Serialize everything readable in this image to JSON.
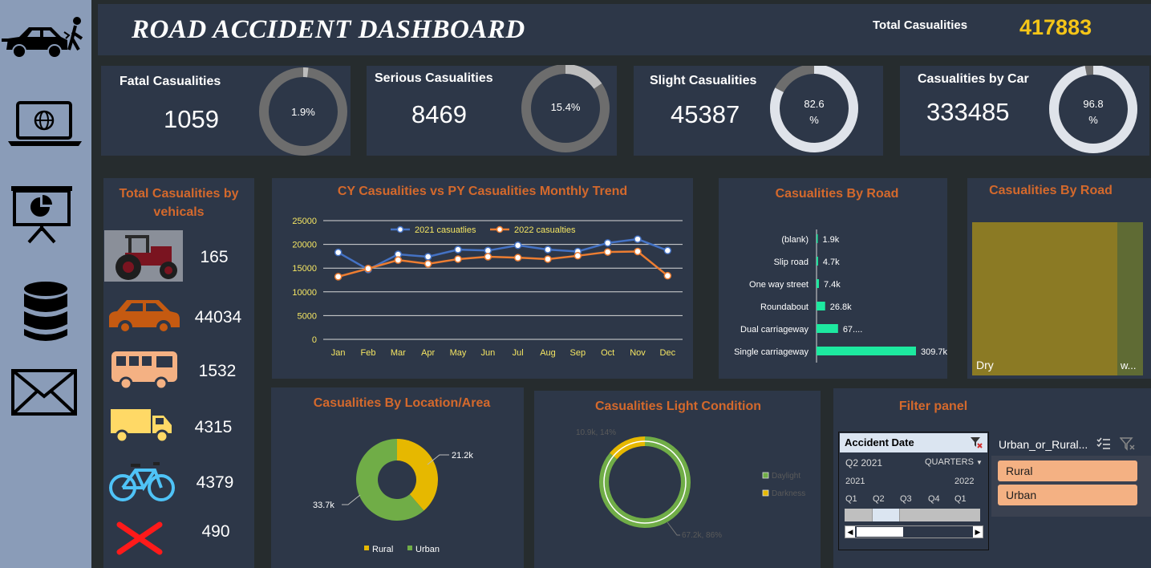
{
  "header": {
    "title": "ROAD ACCIDENT DASHBOARD",
    "total_label": "Total Casualities",
    "total_value": "417883"
  },
  "sidebar": {
    "icons": [
      "car-crash-icon",
      "laptop-globe-icon",
      "presentation-chart-icon",
      "database-icon",
      "mail-icon"
    ]
  },
  "kpis": [
    {
      "label": "Fatal Casualities",
      "value": "1059",
      "pct_text": "1.9%",
      "pct": 1.9
    },
    {
      "label": "Serious Casualities",
      "value": "8469",
      "pct_text": "15.4%",
      "pct": 15.4
    },
    {
      "label": "Slight Casualities",
      "value": "45387",
      "pct_text_line1": "82.6",
      "pct_text_line2": "%",
      "pct": 82.6
    },
    {
      "label": "Casualities by Car",
      "value": "333485",
      "pct_text_line1": "96.8",
      "pct_text_line2": "%",
      "pct": 96.8
    }
  ],
  "vehicles": {
    "title_line1": "Total Casualities by",
    "title_line2": "vehicals",
    "items": [
      {
        "icon": "tractor-icon",
        "value": "165"
      },
      {
        "icon": "car-icon",
        "value": "44034"
      },
      {
        "icon": "bus-icon",
        "value": "1532"
      },
      {
        "icon": "truck-icon",
        "value": "4315"
      },
      {
        "icon": "bicycle-icon",
        "value": "4379"
      },
      {
        "icon": "cross-icon",
        "value": "490"
      }
    ]
  },
  "trend": {
    "title": "CY Casualities vs PY Casualities Monthly Trend",
    "chart_data": {
      "type": "line",
      "categories": [
        "Jan",
        "Feb",
        "Mar",
        "Apr",
        "May",
        "Jun",
        "Jul",
        "Aug",
        "Sep",
        "Oct",
        "Nov",
        "Dec"
      ],
      "series": [
        {
          "name": "2021 casuatlies",
          "color": "#4472c4",
          "values": [
            18300,
            14700,
            17900,
            17400,
            18900,
            18700,
            19800,
            18900,
            18500,
            20300,
            21100,
            18700
          ]
        },
        {
          "name": "2022 casualties",
          "color": "#ed7d31",
          "values": [
            13200,
            14900,
            16700,
            15900,
            16900,
            17400,
            17200,
            16900,
            17600,
            18400,
            18500,
            13400
          ]
        }
      ],
      "yticks": [
        "0",
        "5000",
        "10000",
        "15000",
        "20000",
        "25000"
      ],
      "ylim": [
        0,
        25000
      ],
      "grid": true,
      "legend": "top"
    }
  },
  "road_bar": {
    "title": "Casualities By Road",
    "chart_data": {
      "type": "bar",
      "categories": [
        "(blank)",
        "Slip road",
        "One way street",
        "Roundabout",
        "Dual carriageway",
        "Single carriageway"
      ],
      "values": [
        1900,
        4700,
        7400,
        26800,
        67000,
        309700
      ],
      "labels": [
        "1.9k",
        "4.7k",
        "7.4k",
        "26.8k",
        "67....",
        "309.7k"
      ],
      "color": "#1de9a0"
    }
  },
  "road_tree": {
    "title": "Casualities By Road",
    "chart_data": {
      "type": "treemap",
      "items": [
        {
          "label": "Dry",
          "share": 0.85,
          "color": "#8b7a24"
        },
        {
          "label": "w...",
          "share": 0.15,
          "color": "#5f6b34"
        }
      ]
    }
  },
  "location": {
    "title": "Casualities By Location/Area",
    "chart_data": {
      "type": "pie",
      "categories": [
        "Rural",
        "Urban"
      ],
      "values": [
        21200,
        33700
      ],
      "labels": [
        "21.2k",
        "33.7k"
      ],
      "colors": [
        "#e6b800",
        "#70ad47"
      ],
      "legend": "bottom"
    }
  },
  "light": {
    "title": "Casualities Light Condition",
    "chart_data": {
      "type": "pie",
      "categories": [
        "Daylight",
        "Darkness"
      ],
      "values": [
        86,
        14
      ],
      "labels": [
        "67.2k, 86%",
        "10.9k, 14%"
      ],
      "colors": [
        "#70ad47",
        "#e6b800"
      ],
      "legend": "right"
    }
  },
  "filter": {
    "title": "Filter panel",
    "date_slicer": {
      "header": "Accident Date",
      "selection": "Q2 2021",
      "level": "QUARTERS",
      "year_left": "2021",
      "year_right": "2022",
      "quarters": [
        "Q1",
        "Q2",
        "Q3",
        "Q4",
        "Q1"
      ]
    },
    "area_slicer": {
      "header": "Urban_or_Rural...",
      "items": [
        "Rural",
        "Urban"
      ]
    }
  }
}
